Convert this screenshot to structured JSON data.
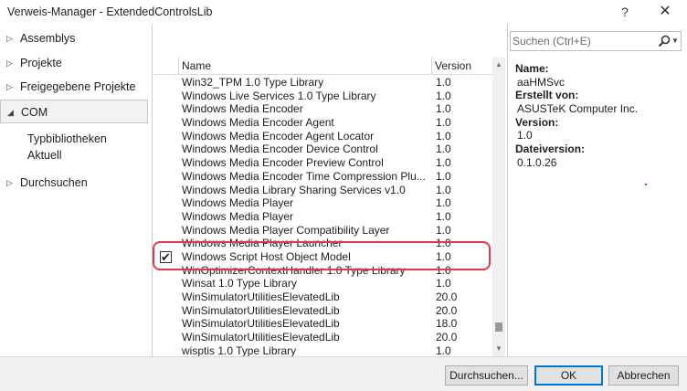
{
  "window": {
    "title": "Verweis-Manager - ExtendedControlsLib",
    "help": "?",
    "close": "✕"
  },
  "sidebar": {
    "items": [
      {
        "label": "Assemblys",
        "arrow": "▷"
      },
      {
        "label": "Projekte",
        "arrow": "▷"
      },
      {
        "label": "Freigegebene Projekte",
        "arrow": "▷"
      },
      {
        "label": "COM",
        "arrow": "◢"
      },
      {
        "label": "Durchsuchen",
        "arrow": "▷"
      }
    ],
    "com_children": [
      "Typbibliotheken",
      "Aktuell"
    ]
  },
  "list": {
    "columns": {
      "name": "Name",
      "version": "Version"
    },
    "rows": [
      {
        "name": "Win32_TPM 1.0 Type Library",
        "version": "1.0",
        "checked": false
      },
      {
        "name": "Windows Live Services 1.0 Type Library",
        "version": "1.0",
        "checked": false
      },
      {
        "name": "Windows Media Encoder",
        "version": "1.0",
        "checked": false
      },
      {
        "name": "Windows Media Encoder Agent",
        "version": "1.0",
        "checked": false
      },
      {
        "name": "Windows Media Encoder Agent Locator",
        "version": "1.0",
        "checked": false
      },
      {
        "name": "Windows Media Encoder Device Control",
        "version": "1.0",
        "checked": false
      },
      {
        "name": "Windows Media Encoder Preview Control",
        "version": "1.0",
        "checked": false
      },
      {
        "name": "Windows Media Encoder Time Compression Plu...",
        "version": "1.0",
        "checked": false
      },
      {
        "name": "Windows Media Library Sharing Services v1.0",
        "version": "1.0",
        "checked": false
      },
      {
        "name": "Windows Media Player",
        "version": "1.0",
        "checked": false
      },
      {
        "name": "Windows Media Player",
        "version": "1.0",
        "checked": false
      },
      {
        "name": "Windows Media Player Compatibility Layer",
        "version": "1.0",
        "checked": false
      },
      {
        "name": "Windows Media Player Launcher",
        "version": "1.0",
        "checked": false
      },
      {
        "name": "Windows Script Host Object Model",
        "version": "1.0",
        "checked": true
      },
      {
        "name": "WinOptimizerContextHandler 1.0 Type Library",
        "version": "1.0",
        "checked": false
      },
      {
        "name": "Winsat 1.0 Type Library",
        "version": "1.0",
        "checked": false
      },
      {
        "name": "WinSimulatorUtilitiesElevatedLib",
        "version": "20.0",
        "checked": false
      },
      {
        "name": "WinSimulatorUtilitiesElevatedLib",
        "version": "20.0",
        "checked": false
      },
      {
        "name": "WinSimulatorUtilitiesElevatedLib",
        "version": "18.0",
        "checked": false
      },
      {
        "name": "WinSimulatorUtilitiesElevatedLib",
        "version": "20.0",
        "checked": false
      },
      {
        "name": "wisptis 1.0 Type Library",
        "version": "1.0",
        "checked": false
      }
    ],
    "check_glyph": "✔"
  },
  "search": {
    "placeholder": "Suchen (Ctrl+E)",
    "value": ""
  },
  "details": [
    {
      "label": "Name:",
      "value": "aaHMSvc"
    },
    {
      "label": "Erstellt von:",
      "value": "ASUSTeK Computer Inc."
    },
    {
      "label": "Version:",
      "value": "1.0"
    },
    {
      "label": "Dateiversion:",
      "value": "0.1.0.26"
    }
  ],
  "footer": {
    "browse": "Durchsuchen...",
    "ok": "OK",
    "cancel": "Abbrechen"
  },
  "colors": {
    "highlight": "#e0393e",
    "default_button_border": "#0078d7"
  }
}
